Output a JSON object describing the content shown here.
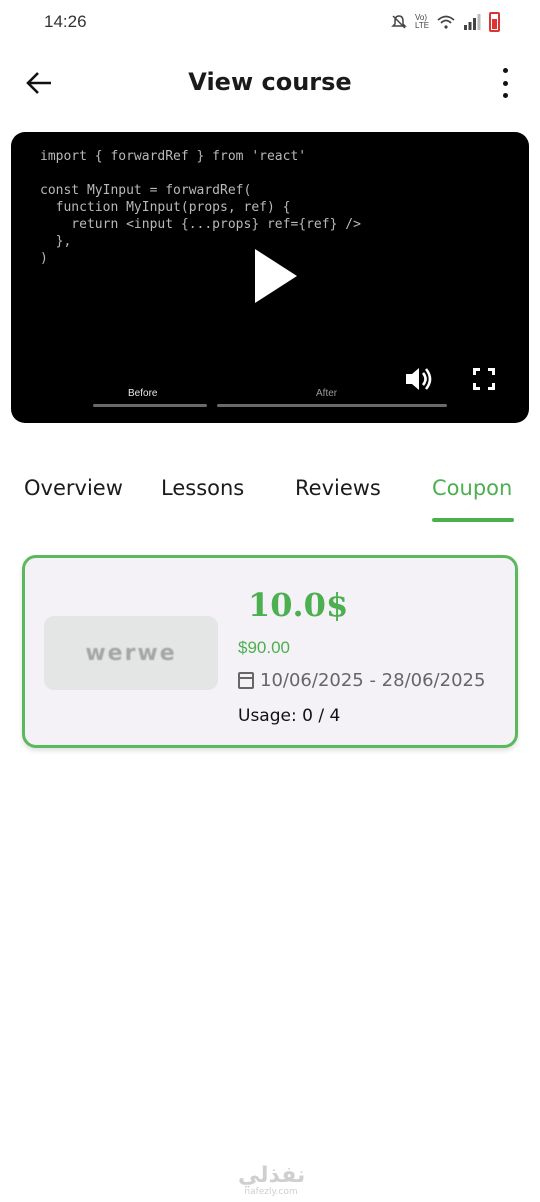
{
  "status_bar": {
    "time": "14:26",
    "network_label": "Vo) LTE",
    "icons": [
      "mute-icon",
      "wifi-icon",
      "signal-icon",
      "battery-icon"
    ],
    "battery_color": "#dd3333"
  },
  "app_bar": {
    "title": "View course",
    "back_icon": "arrow-left-icon",
    "more_icon": "more-vertical-icon"
  },
  "video": {
    "code_lines": [
      "import { forwardRef } from 'react'",
      "",
      "const MyInput = forwardRef(",
      "  function MyInput(props, ref) {",
      "    return <input {...props} ref={ref} />",
      "  },",
      ")"
    ],
    "segments": [
      "Before",
      "After"
    ],
    "controls": [
      "play-icon",
      "volume-icon",
      "fullscreen-icon"
    ]
  },
  "tabs": {
    "items": [
      "Overview",
      "Lessons",
      "Reviews",
      "Coupon"
    ],
    "active": "Coupon",
    "accent_color": "#4caf50"
  },
  "coupon": {
    "image_text": "werwe",
    "discount": "10.0$",
    "price": "$90.00",
    "date_range": "10/06/2025 - 28/06/2025",
    "usage": "Usage: 0 / 4",
    "border_color": "#5cb85c"
  },
  "watermark": {
    "arabic": "نفذلي",
    "url": "nafezly.com"
  }
}
